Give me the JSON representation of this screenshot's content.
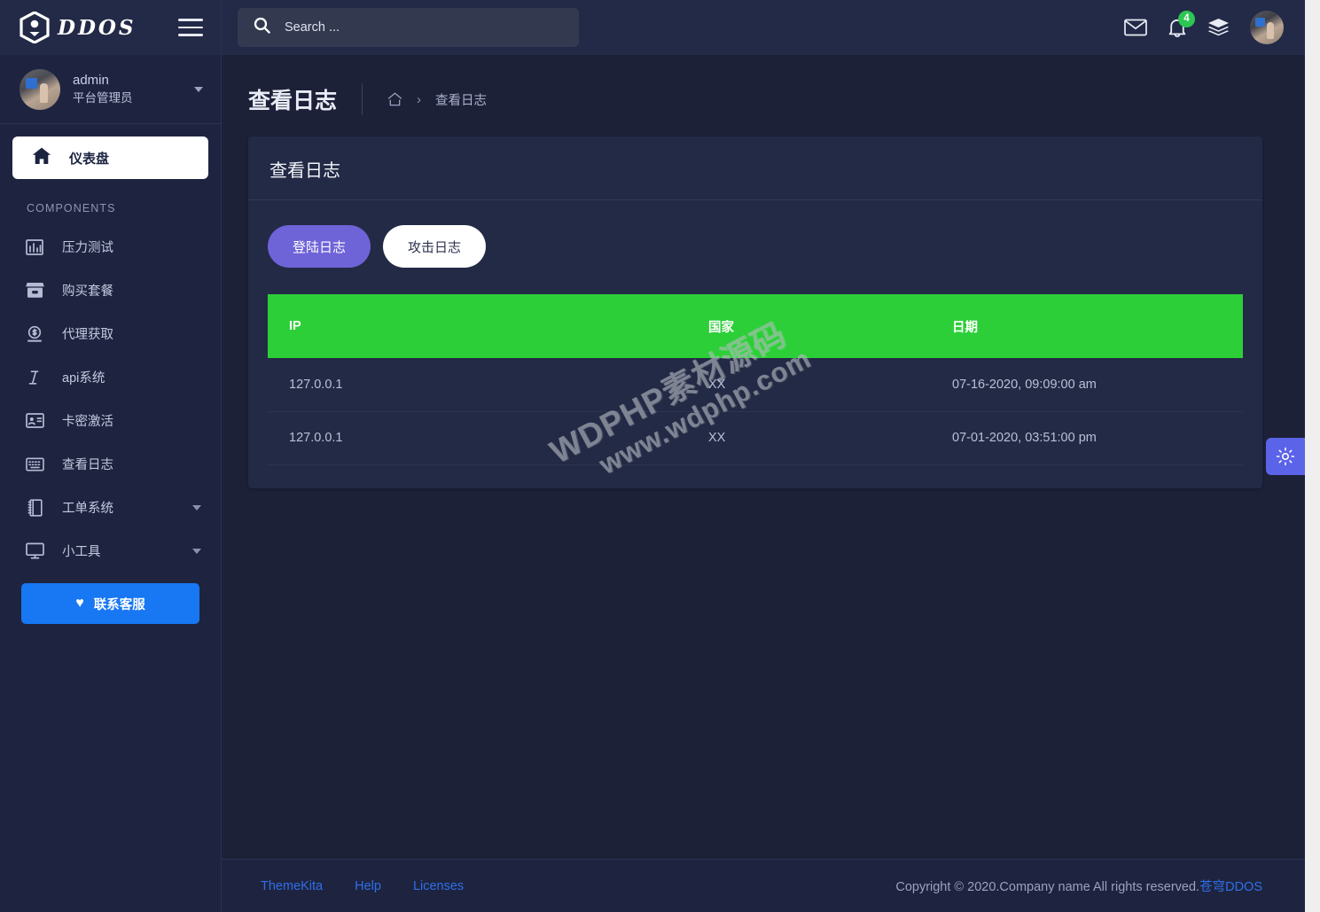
{
  "brand": {
    "name": "DDOS",
    "logo_icon": "shield-hex-icon",
    "menu_toggle_icon": "hamburger-icon"
  },
  "user": {
    "name": "admin",
    "role": "平台管理员",
    "avatar_icon": "user-avatar",
    "caret_icon": "chevron-down-icon"
  },
  "sidebar": {
    "active": {
      "label": "仪表盘",
      "icon": "home-icon"
    },
    "section_label": "COMPONENTS",
    "items": [
      {
        "label": "压力测试",
        "icon": "bar-chart-icon",
        "has_caret": false
      },
      {
        "label": "购买套餐",
        "icon": "store-icon",
        "has_caret": false
      },
      {
        "label": "代理获取",
        "icon": "coin-dollar-icon",
        "has_caret": false
      },
      {
        "label": "api系统",
        "icon": "italic-i-icon",
        "has_caret": false
      },
      {
        "label": "卡密激活",
        "icon": "id-card-icon",
        "has_caret": false
      },
      {
        "label": "查看日志",
        "icon": "keyboard-icon",
        "has_caret": false
      },
      {
        "label": "工单系统",
        "icon": "book-icon",
        "has_caret": true
      },
      {
        "label": "小工具",
        "icon": "monitor-icon",
        "has_caret": true
      }
    ],
    "support_button": {
      "label": "联系客服",
      "icon": "heart-icon",
      "color": "#1877f2"
    }
  },
  "topbar": {
    "search": {
      "value": "",
      "placeholder": "Search ...",
      "icon": "search-icon"
    },
    "mail_icon": "envelope-icon",
    "bell_icon": "bell-icon",
    "notification_count": "4",
    "notification_badge_color": "#2dc653",
    "layers_icon": "layers-icon",
    "avatar_icon": "user-avatar"
  },
  "page": {
    "title": "查看日志",
    "breadcrumb": {
      "home_icon": "home-outline-icon",
      "separator": "›",
      "current": "查看日志"
    }
  },
  "card": {
    "title": "查看日志",
    "tabs": [
      {
        "label": "登陆日志",
        "active": true,
        "color": "#6f63d8"
      },
      {
        "label": "攻击日志",
        "active": false,
        "color": "#ffffff"
      }
    ],
    "table": {
      "header_color": "#2dcf38",
      "columns": [
        "IP",
        "国家",
        "日期"
      ],
      "rows": [
        [
          "127.0.0.1",
          "XX",
          "07-16-2020, 09:09:00 am"
        ],
        [
          "127.0.0.1",
          "XX",
          "07-01-2020, 03:51:00 pm"
        ]
      ]
    }
  },
  "settings_tab": {
    "icon": "gear-icon",
    "color": "#5b63e8"
  },
  "footer": {
    "links": [
      "ThemeKita",
      "Help",
      "Licenses"
    ],
    "copyright_text": "Copyright © 2020.Company name All rights reserved.",
    "copyright_link": "苍穹DDOS"
  },
  "watermark": {
    "line1": "WDPHP素材源码",
    "line2": "www.wdphp.com"
  }
}
